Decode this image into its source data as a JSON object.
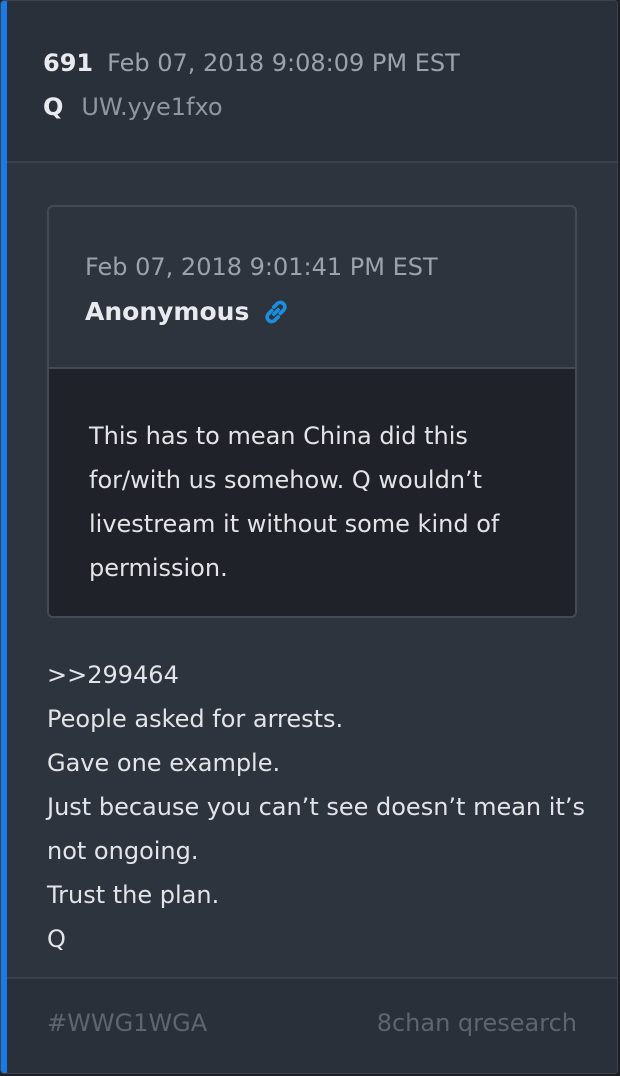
{
  "post": {
    "number": "691",
    "timestamp": "Feb 07, 2018 9:08:09 PM EST",
    "author": "Q",
    "tripcode": "UW.yye1fxo"
  },
  "quoted_post": {
    "timestamp": "Feb 07, 2018 9:01:41 PM EST",
    "author": "Anonymous",
    "link_icon": "link-icon",
    "text_lines": [
      "This has to mean China did this",
      "for/with us somehow.  Q wouldn’t",
      "livestream it without some kind of",
      "permission."
    ]
  },
  "body_lines": [
    ">>299464",
    "People asked for arrests.",
    "Gave one example.",
    "Just because you can’t see doesn’t mean it’s",
    "not ongoing.",
    "Trust the plan.",
    "Q"
  ],
  "footer": {
    "hashtag": "#WWG1WGA",
    "source": "8chan qresearch"
  },
  "colors": {
    "accent": "#1a7ae8",
    "link": "#1a8fe0",
    "background": "#2e343e"
  }
}
